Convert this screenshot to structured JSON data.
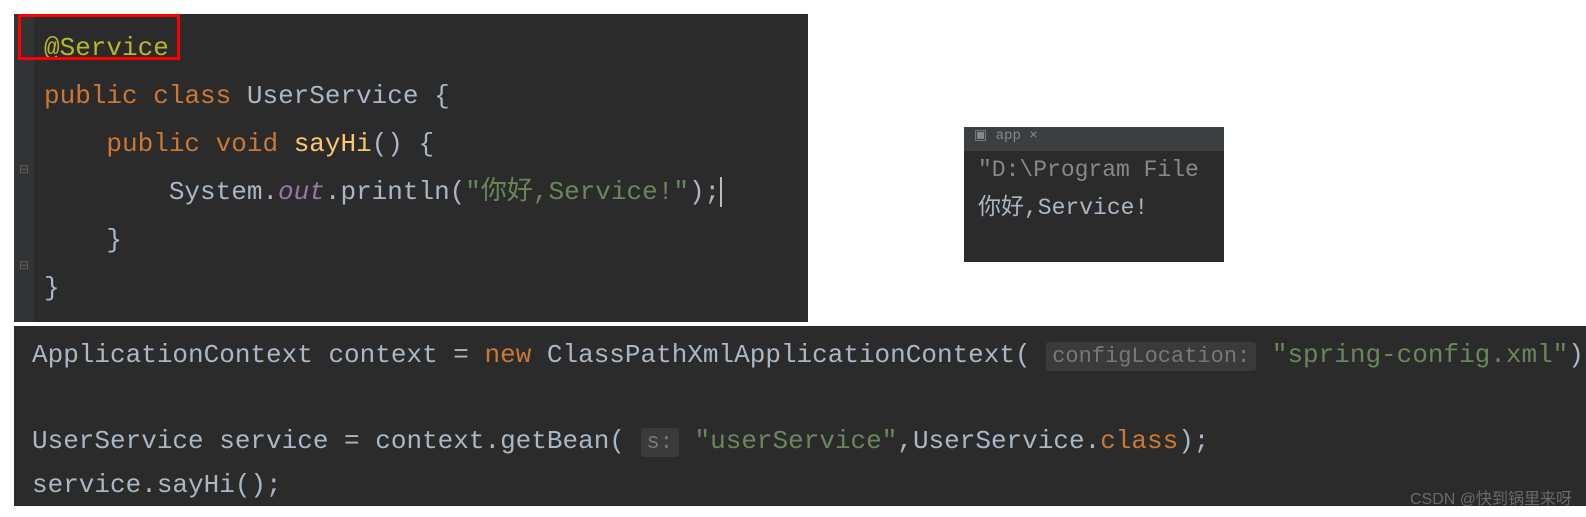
{
  "panel1": {
    "line1": "@Service",
    "line2_kw1": "public",
    "line2_kw2": "class",
    "line2_name": "UserService {",
    "line3_kw1": "public",
    "line3_kw2": "void",
    "line3_method": "sayHi",
    "line3_rest": "() {",
    "line4_class": "System.",
    "line4_field": "out",
    "line4_method": ".println(",
    "line4_string": "\"你好,Service!\"",
    "line4_end": ");",
    "line5": "    }",
    "line6": "}"
  },
  "console": {
    "tab": "app",
    "line1": "\"D:\\Program File",
    "line2": "你好,Service!"
  },
  "panel2": {
    "line1_part1": "ApplicationContext context = ",
    "line1_kw": "new",
    "line1_part2": " ClassPathXmlApplicationContext( ",
    "line1_hint": "configLocation:",
    "line1_string": " \"spring-config.xml\"",
    "line1_end": ")",
    "line3_part1": "UserService service = context.getBean( ",
    "line3_hint": "s:",
    "line3_string": " \"userService\"",
    "line3_part2": ",UserService.",
    "line3_kw": "class",
    "line3_end": ");",
    "line4": "service.sayHi();"
  },
  "watermark": "CSDN @快到锅里来呀"
}
